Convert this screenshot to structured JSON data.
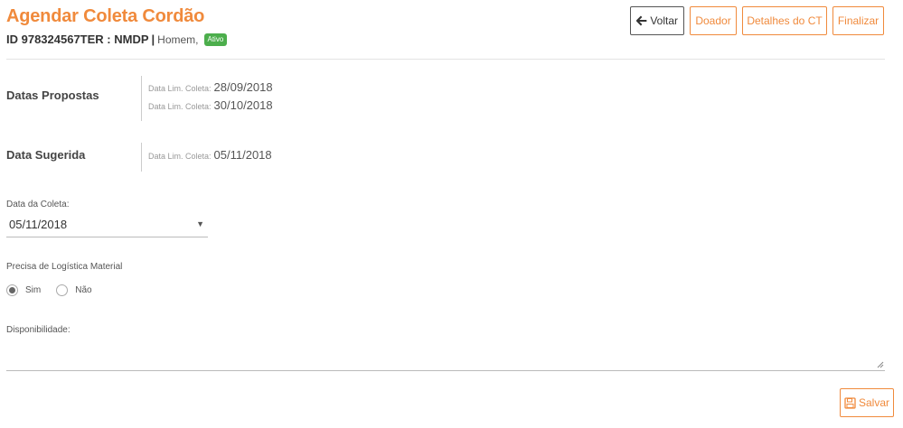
{
  "header": {
    "title": "Agendar Coleta Cordão",
    "id_text": "ID 978324567TER : NMDP",
    "separator": "|",
    "gender": "Homem,",
    "status_badge": "Ativo"
  },
  "toolbar": {
    "voltar_label": "Voltar",
    "doador_label": "Doador",
    "detalhes_label": "Detalhes do CT",
    "finalizar_label": "Finalizar"
  },
  "datas_propostas": {
    "label": "Datas Propostas",
    "items": [
      {
        "label": "Data Lim. Coleta:",
        "value": "28/09/2018"
      },
      {
        "label": "Data Lim. Coleta:",
        "value": "30/10/2018"
      }
    ]
  },
  "data_sugerida": {
    "label": "Data Sugerida",
    "item": {
      "label": "Data Lim. Coleta:",
      "value": "05/11/2018"
    }
  },
  "data_coleta": {
    "label": "Data da Coleta:",
    "selected": "05/11/2018"
  },
  "logistica": {
    "label": "Precisa de Logística Material",
    "options": [
      {
        "label": "Sim",
        "checked": true
      },
      {
        "label": "Não",
        "checked": false
      }
    ]
  },
  "disponibilidade": {
    "label": "Disponibilidade:",
    "value": ""
  },
  "footer": {
    "salvar_label": "Salvar"
  },
  "colors": {
    "accent": "#f08a3c",
    "badge": "#4cae4c"
  }
}
